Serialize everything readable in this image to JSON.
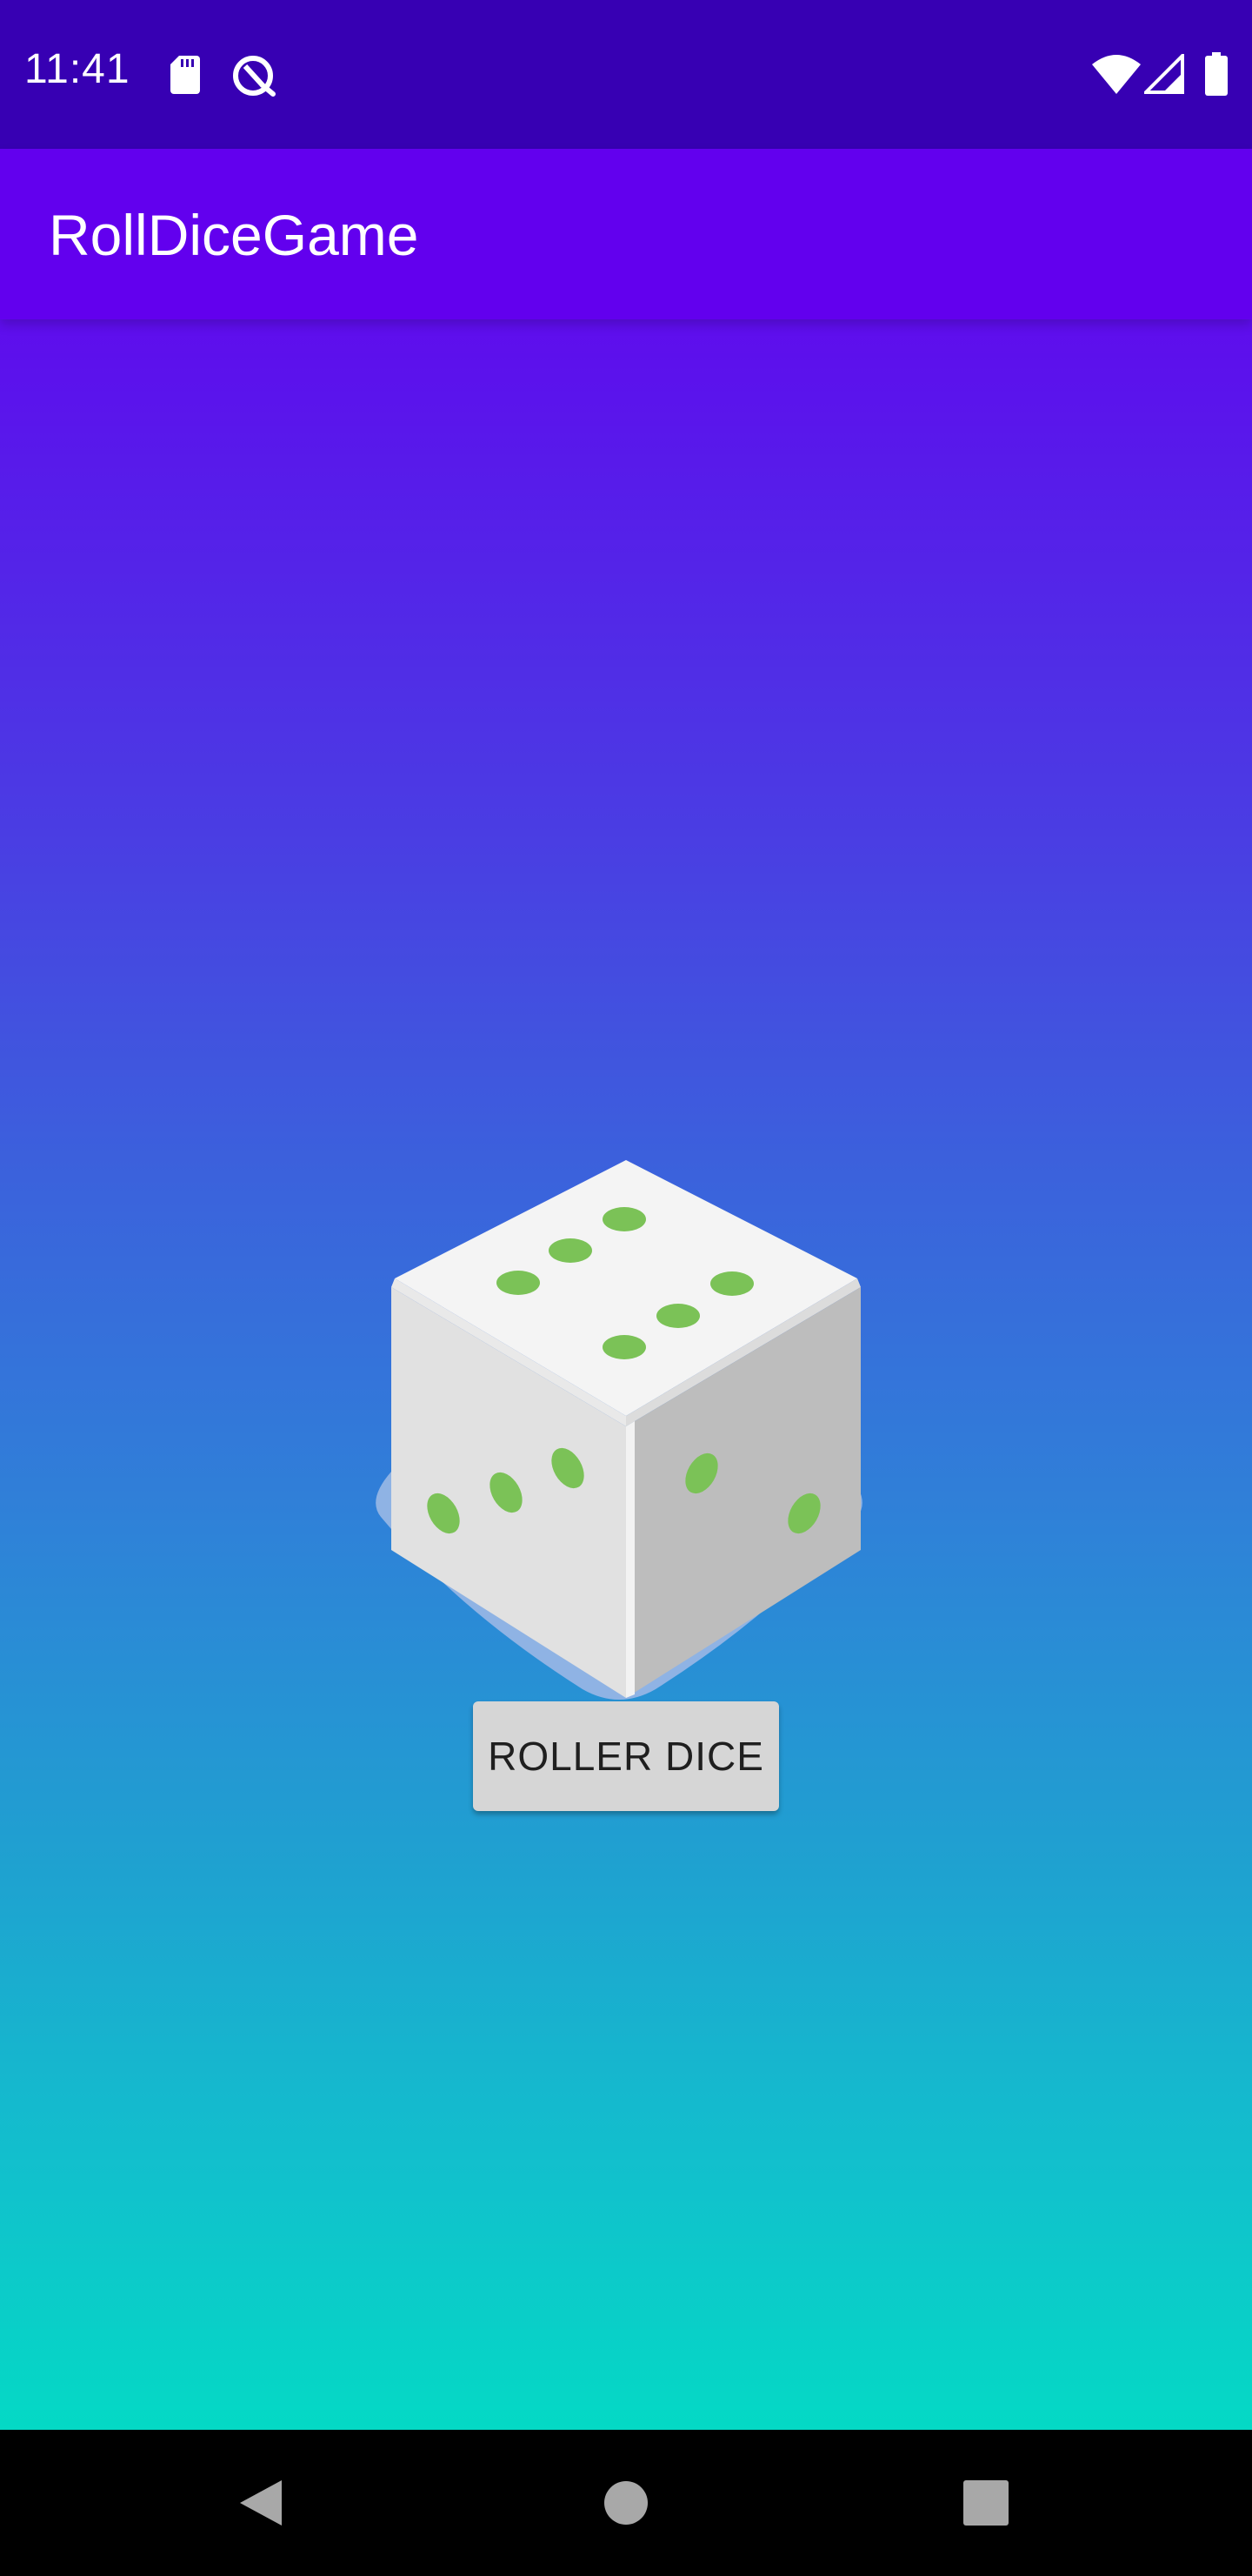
{
  "status_bar": {
    "time": "11:41",
    "icons_left": [
      "sd-card-icon",
      "data-saver-icon"
    ],
    "icons_right": [
      "wifi-icon",
      "signal-icon",
      "battery-icon"
    ]
  },
  "app_bar": {
    "title": "RollDiceGame"
  },
  "main": {
    "dice_image": "dice-icon",
    "roll_button_label": "ROLLER DICE"
  },
  "nav_bar": {
    "buttons": [
      "back-icon",
      "home-icon",
      "recents-icon"
    ]
  },
  "colors": {
    "status_bar": "#3700b3",
    "app_bar": "#6200ee",
    "gradient_top": "#6a00f0",
    "gradient_bottom": "#04d9c5",
    "pip": "#7bc257",
    "button": "#d6d6d6"
  }
}
